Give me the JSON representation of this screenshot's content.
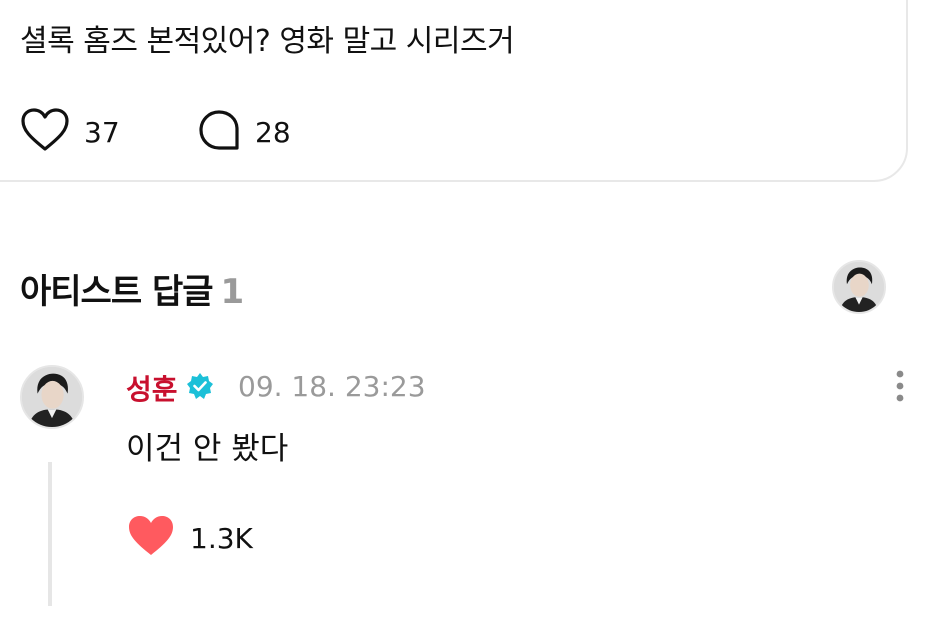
{
  "post": {
    "text": "셜록 홈즈 본적있어? 영화 말고 시리즈거",
    "like_count": "37",
    "comment_count": "28"
  },
  "section": {
    "title": "아티스트 답글",
    "count": "1"
  },
  "reply": {
    "author": "성훈",
    "timestamp": "09. 18. 23:23",
    "text": "이건 안 봤다",
    "like_count": "1.3K"
  },
  "colors": {
    "author": "#c8102e",
    "verified": "#1cc0d8",
    "liked_heart": "#ff5a5f"
  },
  "icons": [
    "heart-outline-icon",
    "comment-bubble-icon",
    "verified-badge-icon",
    "more-vertical-icon",
    "heart-filled-icon"
  ]
}
